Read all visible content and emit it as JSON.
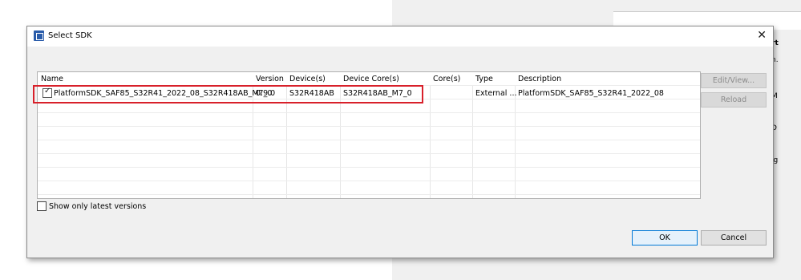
{
  "dialog": {
    "title": "Select SDK",
    "close_glyph": "✕"
  },
  "table": {
    "headers": [
      "Name",
      "Version",
      "Device(s)",
      "Device Core(s)",
      "Core(s)",
      "Type",
      "Description"
    ],
    "rows": [
      {
        "checked": true,
        "name": "PlatformSDK_SAF85_S32R41_2022_08_S32R418AB_M7_0",
        "version": "0.9.0",
        "devices": "S32R418AB",
        "device_cores": "S32R418AB_M7_0",
        "cores": "",
        "type": "External ...",
        "description": "PlatformSDK_SAF85_S32R41_2022_08"
      }
    ]
  },
  "side_buttons": {
    "edit_view": "Edit/View...",
    "reload": "Reload"
  },
  "show_latest": {
    "label": "Show only latest versions",
    "checked": false
  },
  "footer": {
    "ok": "OK",
    "cancel": "Cancel"
  },
  "background_fragments": [
    "rt",
    "n.",
    "M",
    "D",
    "ig"
  ],
  "colors": {
    "highlight": "#d8202a",
    "ok_border": "#0078d7"
  }
}
